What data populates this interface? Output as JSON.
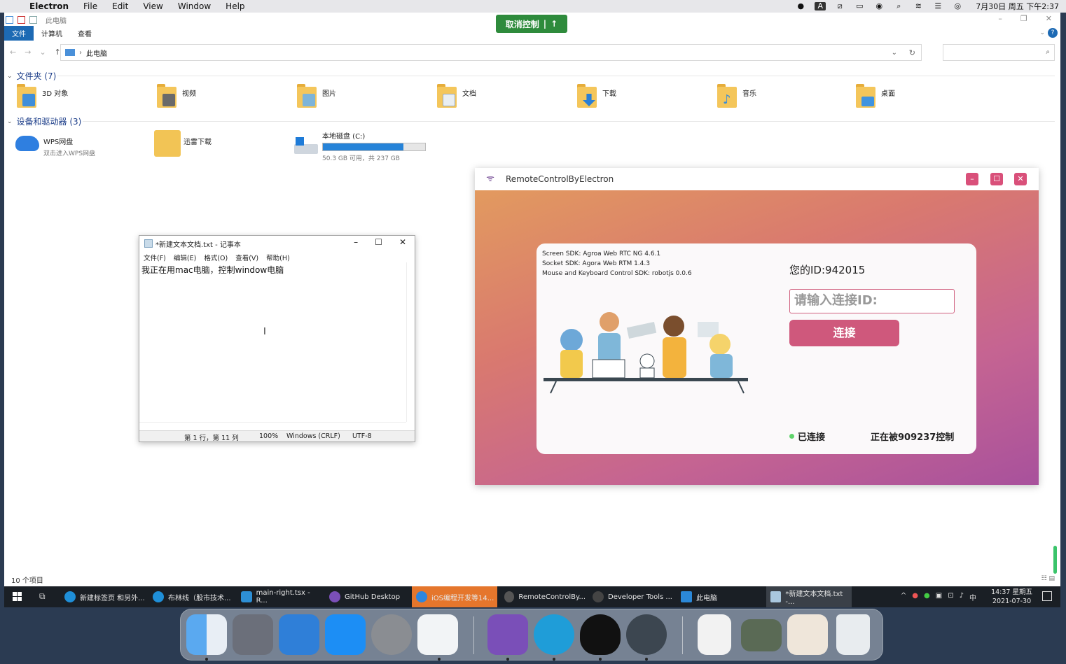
{
  "menubar": {
    "app_name": "Electron",
    "items": [
      "File",
      "Edit",
      "View",
      "Window",
      "Help"
    ],
    "clock": "7月30日 周五 下午2:37",
    "input_indicator": "A"
  },
  "explorer": {
    "window_title": "此电脑",
    "ribbon_tabs": [
      "文件",
      "计算机",
      "查看"
    ],
    "address": "此电脑",
    "folders_header": "文件夹 (7)",
    "folders": [
      {
        "name": "3D 对象",
        "accent": "#3f8ed9"
      },
      {
        "name": "视频",
        "accent": "#6a6a6a"
      },
      {
        "name": "图片",
        "accent": "#7db4d9"
      },
      {
        "name": "文档",
        "accent": "#e9eef2"
      },
      {
        "name": "下载",
        "accent": "#2a7fd6"
      },
      {
        "name": "音乐",
        "accent": "#3b8ed8"
      },
      {
        "name": "桌面",
        "accent": "#3f93e0"
      }
    ],
    "devices_header": "设备和驱动器 (3)",
    "wps": {
      "name": "WPS网盘",
      "sub": "双击进入WPS网盘"
    },
    "xunlei": {
      "name": "迅雷下载"
    },
    "disk": {
      "name": "本地磁盘 (C:)",
      "sub": "50.3 GB 可用，共 237 GB",
      "used_fraction": 0.79
    },
    "item_count": "10 个项目"
  },
  "remote_toolbar": {
    "cancel_label": "取消控制",
    "arrow": "↑"
  },
  "notepad": {
    "title": "*新建文本文档.txt - 记事本",
    "menu": [
      "文件(F)",
      "编辑(E)",
      "格式(O)",
      "查看(V)",
      "帮助(H)"
    ],
    "content": "我正在用mac电脑，控制window电脑",
    "status": {
      "position": "第 1 行，第 11 列",
      "zoom": "100%",
      "eol": "Windows (CRLF)",
      "encoding": "UTF-8"
    }
  },
  "remote_app": {
    "title": "RemoteControlByElectron",
    "sdk_lines": [
      "Screen SDK: Agroa Web RTC NG 4.6.1",
      "Socket SDK: Agora Web RTM 1.4.3",
      "Mouse and Keyboard Control SDK: robotjs 0.0.6"
    ],
    "my_id": "您的ID:942015",
    "connect_placeholder": "请输入连接ID:",
    "connect_button": "连接",
    "status": "已连接",
    "controlled_by": "正在被909237控制",
    "colors": {
      "accent": "#cf587c",
      "minimize": "#d9507a",
      "maximize": "#d9507a",
      "close": "#d9507a"
    }
  },
  "taskbar": {
    "items": [
      {
        "label": "新建标签页 和另外..."
      },
      {
        "label": "布林线（股市技术..."
      },
      {
        "label": "main-right.tsx - R..."
      },
      {
        "label": "GitHub Desktop"
      },
      {
        "label": "iOS编程开发等14..."
      },
      {
        "label": "RemoteControlBy..."
      },
      {
        "label": "Developer Tools ..."
      },
      {
        "label": "此电脑"
      },
      {
        "label": "*新建文本文档.txt -..."
      }
    ],
    "time": "14:37 星期五",
    "date": "2021-07-30",
    "ime": "中"
  }
}
